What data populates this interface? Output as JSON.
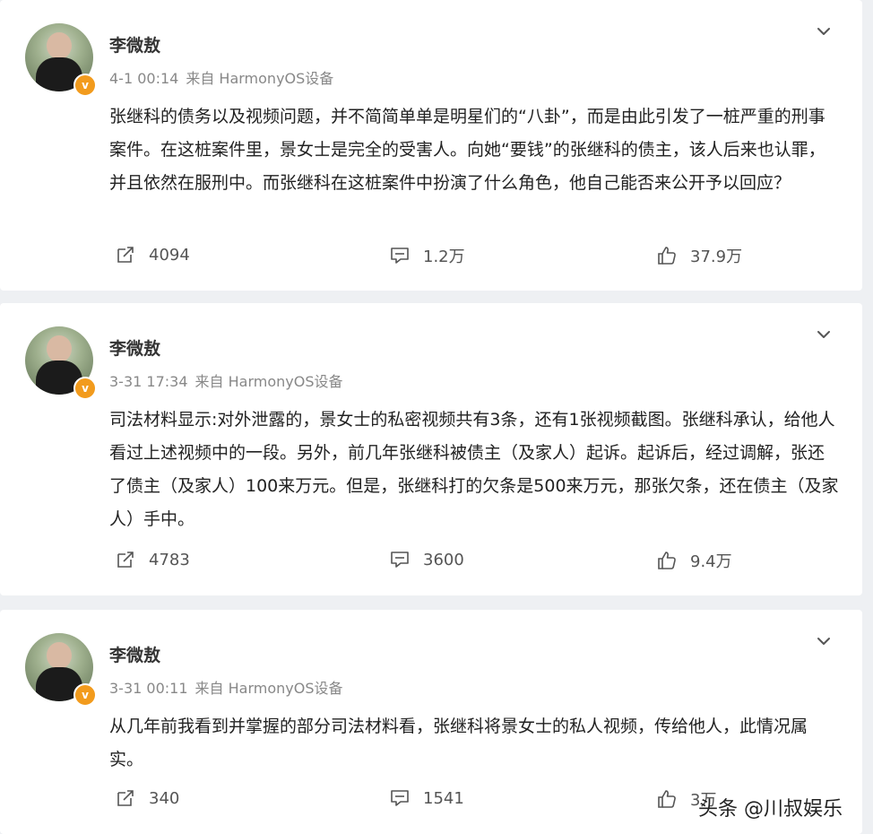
{
  "posts": [
    {
      "username": "李微敖",
      "timestamp": "4-1 00:14",
      "source": "来自 HarmonyOS设备",
      "content": "张继科的债务以及视频问题，并不简简单单是明星们的“八卦”，而是由此引发了一桩严重的刑事案件。在这桩案件里，景女士是完全的受害人。向她“要钱”的张继科的债主，该人后来也认罪，并且依然在服刑中。而张继科在这桩案件中扮演了什么角色，他自己能否来公开予以回应？",
      "reposts": "4094",
      "comments": "1.2万",
      "likes": "37.9万"
    },
    {
      "username": "李微敖",
      "timestamp": "3-31 17:34",
      "source": "来自 HarmonyOS设备",
      "content": "司法材料显示:对外泄露的，景女士的私密视频共有3条，还有1张视频截图。张继科承认，给他人看过上述视频中的一段。另外，前几年张继科被债主（及家人）起诉。起诉后，经过调解，张还了债主（及家人）100来万元。但是，张继科打的欠条是500来万元，那张欠条，还在债主（及家人）手中。",
      "reposts": "4783",
      "comments": "3600",
      "likes": "9.4万"
    },
    {
      "username": "李微敖",
      "timestamp": "3-31 00:11",
      "source": "来自 HarmonyOS设备",
      "content": "从几年前我看到并掌握的部分司法材料看，张继科将景女士的私人视频，传给他人，此情况属实。",
      "reposts": "340",
      "comments": "1541",
      "likes": "3万"
    }
  ],
  "watermark": "头条 @川叔娱乐",
  "icons": {
    "repost": "repost-icon",
    "comment": "comment-icon",
    "like": "thumbs-up-icon",
    "menu": "chevron-down-icon",
    "verified": "verified-badge-icon"
  },
  "colors": {
    "background": "#eef0f3",
    "card": "#ffffff",
    "verified_badge": "#f29b1d",
    "meta_text": "#888888"
  }
}
